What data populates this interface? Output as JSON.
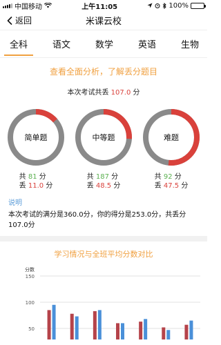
{
  "status_bar": {
    "carrier": "中国移动",
    "time": "上午11:05",
    "battery": "100%"
  },
  "nav": {
    "back_label": "返回",
    "title": "米课云校"
  },
  "tabs": [
    "全科",
    "语文",
    "数学",
    "英语",
    "生物"
  ],
  "headline": "查看全面分析，了解丢分题目",
  "lost_total": {
    "prefix": "本次考试共丢",
    "value": "107.0",
    "suffix": "分"
  },
  "rings": [
    {
      "label": "简单题",
      "total": "81",
      "lost": "11.0",
      "lost_fraction": 0.136
    },
    {
      "label": "中等题",
      "total": "187",
      "lost": "48.5",
      "lost_fraction": 0.259
    },
    {
      "label": "难题",
      "total": "92",
      "lost": "47.5",
      "lost_fraction": 0.516
    }
  ],
  "ring_text": {
    "total_prefix": "共",
    "lost_prefix": "丢",
    "unit": "分"
  },
  "colors": {
    "accent": "#f0a040",
    "ring_gray": "#8a8a8a",
    "ring_red": "#d9413b",
    "green": "#5bb050",
    "note_blue": "#5a9bd8",
    "bar_red": "#b5434a",
    "bar_blue": "#4a90d9"
  },
  "note": {
    "title": "说明",
    "text": "本次考试的满分是360.0分，你的得分是253.0分，共丢分107.0分"
  },
  "chart_data": {
    "type": "bar",
    "title": "学习情况与全班平均分数对比",
    "ylabel": "分数",
    "ylim": [
      0,
      150
    ],
    "yticks": [
      50,
      100,
      150
    ],
    "grid": true,
    "series": [
      {
        "values": [
          85,
          78,
          83,
          60,
          63,
          52,
          57
        ]
      },
      {
        "values": [
          95,
          73,
          85,
          60,
          68,
          47,
          65
        ]
      }
    ]
  }
}
